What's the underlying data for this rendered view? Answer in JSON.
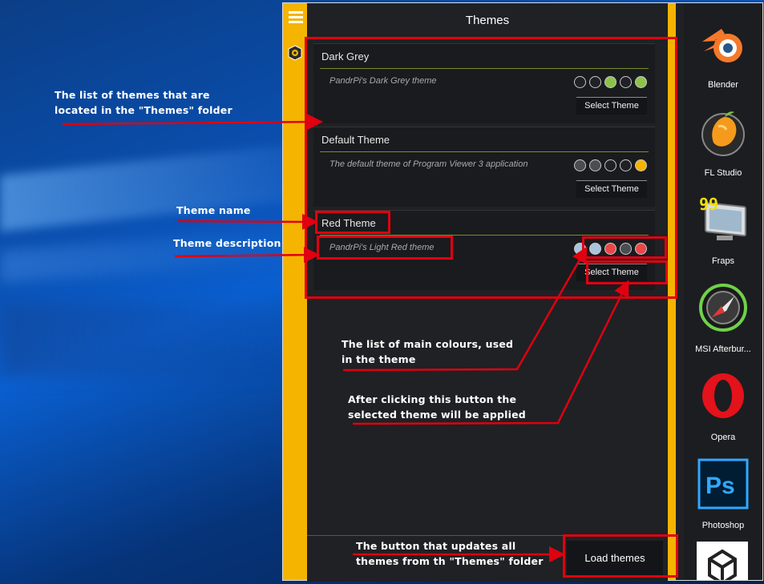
{
  "app": {
    "title": "Themes",
    "load_button": "Load themes",
    "themes": [
      {
        "name": "Dark Grey",
        "description": "PandrPi's Dark Grey theme",
        "colors": [
          "#1f2124",
          "#1f2124",
          "#8bc34a",
          "#1f2124",
          "#8bc34a"
        ],
        "button": "Select Theme"
      },
      {
        "name": "Default Theme",
        "description": "The default theme of Program Viewer 3 application",
        "colors": [
          "#4a4d52",
          "#4a4d52",
          "#1f2124",
          "#1f2124",
          "#f4b400"
        ],
        "button": "Select Theme"
      },
      {
        "name": "Red Theme",
        "description": "PandrPi's Light Red theme",
        "colors": [
          "#aac4dc",
          "#aac4dc",
          "#e84848",
          "#4a4d52",
          "#e84848"
        ],
        "button": "Select Theme"
      }
    ]
  },
  "dock": [
    {
      "label": "Blender",
      "icon": "blender-icon"
    },
    {
      "label": "FL Studio",
      "icon": "fl-studio-icon"
    },
    {
      "label": "Fraps",
      "icon": "fraps-icon"
    },
    {
      "label": "MSI Afterbur...",
      "icon": "msi-afterburner-icon"
    },
    {
      "label": "Opera",
      "icon": "opera-icon"
    },
    {
      "label": "Photoshop",
      "icon": "photoshop-icon"
    },
    {
      "label": "",
      "icon": "unity-icon"
    }
  ],
  "icons": {
    "fraps_number": "99",
    "photoshop_text": "Ps"
  },
  "annotations": {
    "theme_list": "The list of themes that are located in the \"Themes\" folder",
    "theme_name": "Theme name",
    "theme_description": "Theme description",
    "main_colours": "The list of main colours, used in the theme",
    "select_button": "After clicking this button the selected theme will be applied",
    "load_button": "The button that updates all themes from th \"Themes\" folder"
  },
  "colors": {
    "accent": "#f4b400",
    "annotation_red": "#e00010",
    "panel_bg": "#1f2124"
  }
}
